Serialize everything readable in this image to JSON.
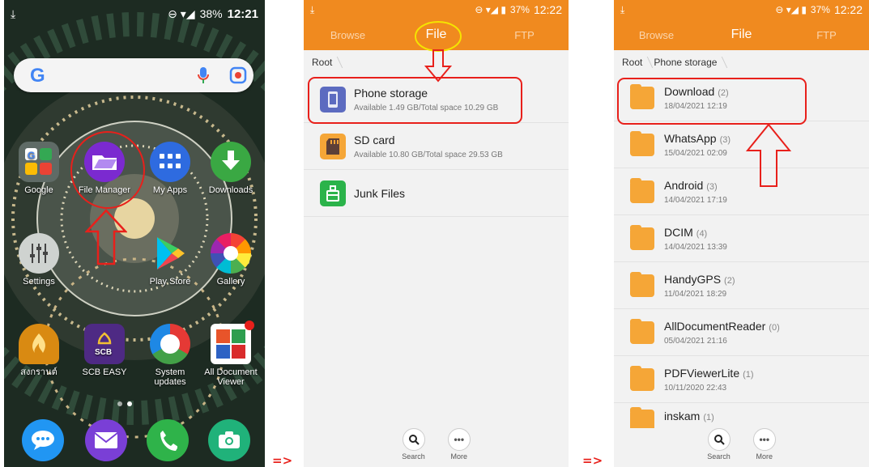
{
  "separators": [
    "=>",
    "=>"
  ],
  "home": {
    "statusbar": {
      "left_icon": "download-icon",
      "battery": "38%",
      "time": "12:21"
    },
    "search": {
      "logo": "G"
    },
    "apps": [
      {
        "label": "Google",
        "icon": "google-folder-icon"
      },
      {
        "label": "File Manager",
        "icon": "file-manager-icon"
      },
      {
        "label": "My Apps",
        "icon": "grid-icon"
      },
      {
        "label": "Downloads",
        "icon": "download-icon"
      },
      {
        "label": "Settings",
        "icon": "settings-icon"
      },
      {
        "label": "Play Store",
        "icon": "play-store-icon"
      },
      {
        "label": "Gallery",
        "icon": "gallery-icon"
      },
      {
        "label": "สงกรานต์",
        "icon": "festival-icon"
      },
      {
        "label": "SCB EASY",
        "icon": "scb-icon"
      },
      {
        "label": "System updates",
        "icon": "update-icon"
      },
      {
        "label": "All Document Viewer",
        "icon": "document-viewer-icon"
      }
    ],
    "dock": [
      "messages-icon",
      "email-icon",
      "phone-icon",
      "camera-icon"
    ]
  },
  "fm1": {
    "statusbar": {
      "battery": "37%",
      "time": "12:22"
    },
    "tabs": [
      "Browse",
      "File",
      "FTP"
    ],
    "active_tab": "File",
    "breadcrumb": [
      "Root"
    ],
    "items": [
      {
        "title": "Phone storage",
        "subtitle": "Available 1.49 GB/Total space 10.29 GB",
        "icon": "phone-storage-icon"
      },
      {
        "title": "SD card",
        "subtitle": "Available 10.80 GB/Total space 29.53 GB",
        "icon": "sd-card-icon"
      },
      {
        "title": "Junk Files",
        "subtitle": "",
        "icon": "junk-files-icon"
      }
    ],
    "bottom": [
      {
        "label": "Search",
        "icon": "search-icon"
      },
      {
        "label": "More",
        "icon": "more-icon"
      }
    ]
  },
  "fm2": {
    "statusbar": {
      "battery": "37%",
      "time": "12:22"
    },
    "tabs": [
      "Browse",
      "File",
      "FTP"
    ],
    "active_tab": "File",
    "breadcrumb": [
      "Root",
      "Phone storage"
    ],
    "folders": [
      {
        "name": "Download",
        "count": "(2)",
        "date": "18/04/2021 12:19"
      },
      {
        "name": "WhatsApp",
        "count": "(3)",
        "date": "15/04/2021 02:09"
      },
      {
        "name": "Android",
        "count": "(3)",
        "date": "14/04/2021 17:19"
      },
      {
        "name": "DCIM",
        "count": "(4)",
        "date": "14/04/2021 13:39"
      },
      {
        "name": "HandyGPS",
        "count": "(2)",
        "date": "11/04/2021 18:29"
      },
      {
        "name": "AllDocumentReader",
        "count": "(0)",
        "date": "05/04/2021 21:16"
      },
      {
        "name": "PDFViewerLite",
        "count": "(1)",
        "date": "10/11/2020 22:43"
      },
      {
        "name": "inskam",
        "count": "(1)",
        "date": ""
      }
    ],
    "bottom": [
      {
        "label": "Search",
        "icon": "search-icon"
      },
      {
        "label": "More",
        "icon": "more-icon"
      }
    ]
  },
  "colors": {
    "accent": "#f08a1f",
    "folder": "#f5a637",
    "highlight": "#e8201b",
    "tab_circle": "#f5e400"
  }
}
